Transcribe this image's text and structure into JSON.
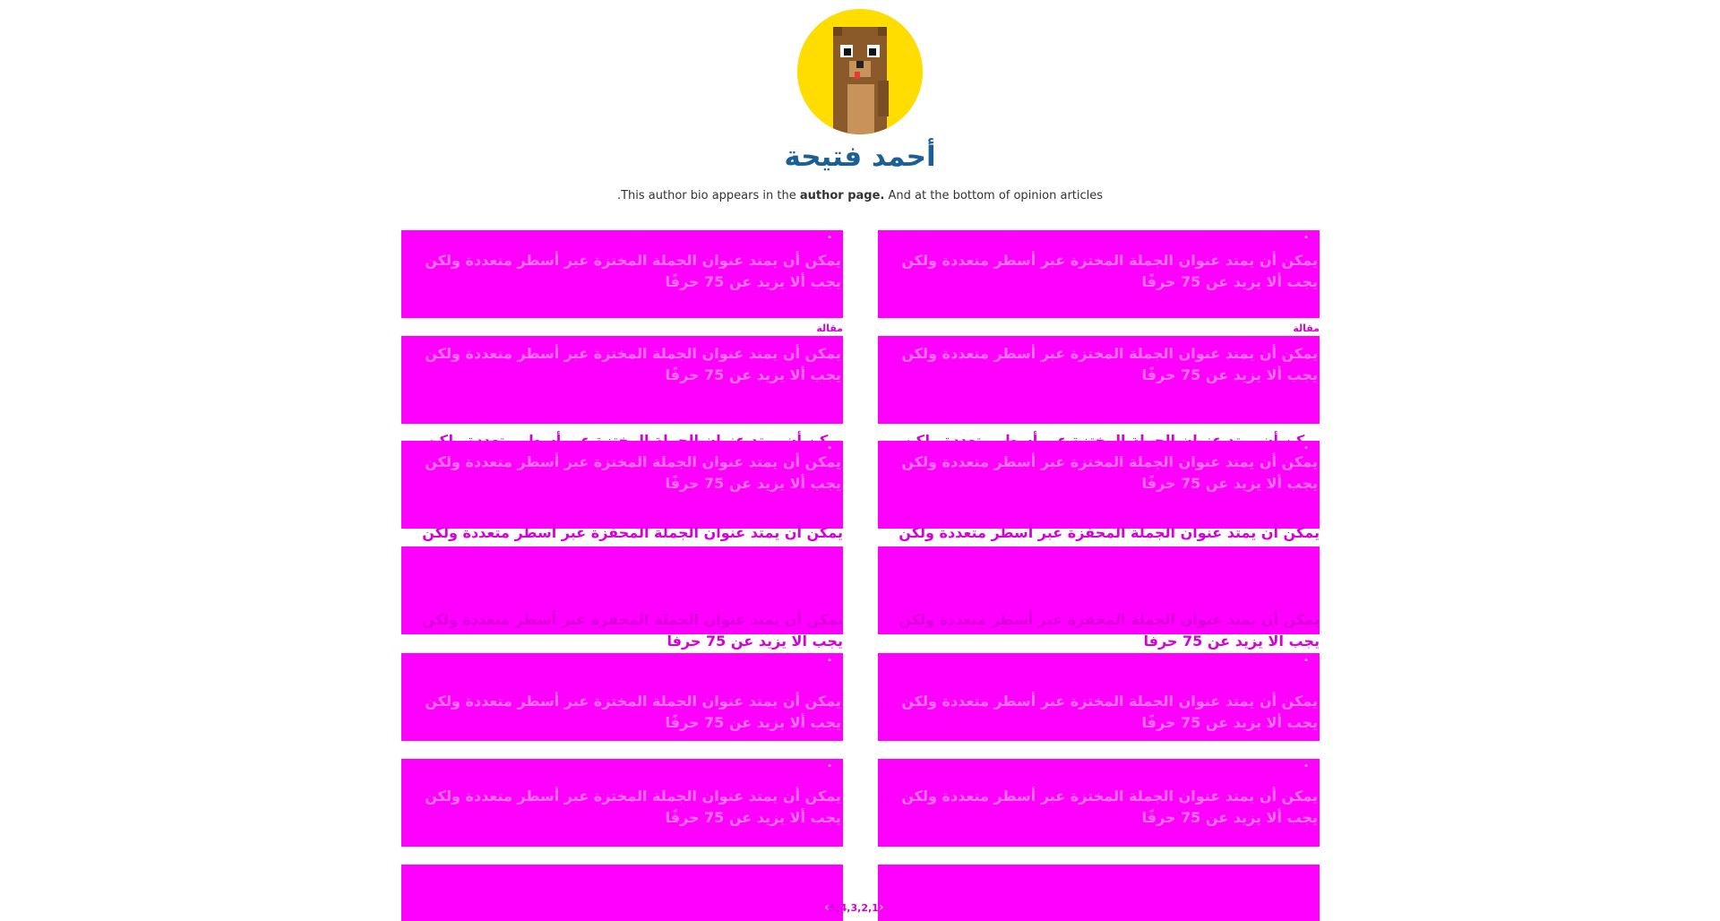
{
  "author": {
    "name": "أحمد فتيحة",
    "bio_before": ".This author bio appears in the ",
    "bio_bold": "author page.",
    "bio_after": " And at the bottom of opinion articles",
    "avatar_icon": "pixel-bear-avatar-icon"
  },
  "card_headline": "يمكن أن يمتد عنوان الجملة المختزة عبر أسطر متعددة ولكن يجب ألا يزيد عن 75 حرفًا",
  "card_headline_variant": "يمكن أن يمتد عنوان الجملة المحفزة عبر أسطر متعددة ولكن يجب الا يزيد عن 75 حرفا",
  "section_label": "مقالة",
  "cards": [
    {
      "text": "يمكن أن يمتد عنوان الجملة المختزة عبر أسطر متعددة ولكن يجب ألا يزيد عن 75 حرفًا"
    },
    {
      "text": "يمكن أن يمتد عنوان الجملة المختزة عبر أسطر متعددة ولكن يجب ألا يزيد عن 75 حرفًا"
    }
  ],
  "pagination": {
    "pages": [
      "1",
      "2",
      "3",
      "4",
      "5"
    ],
    "prev_icon": "chevron-left-icon",
    "next_icon": "chevron-right-icon"
  },
  "colors": {
    "card_bg": "#ff00ff",
    "accent_text": "#d800d8",
    "author_name": "#1a5f96",
    "avatar_bg": "#ffdd00"
  }
}
